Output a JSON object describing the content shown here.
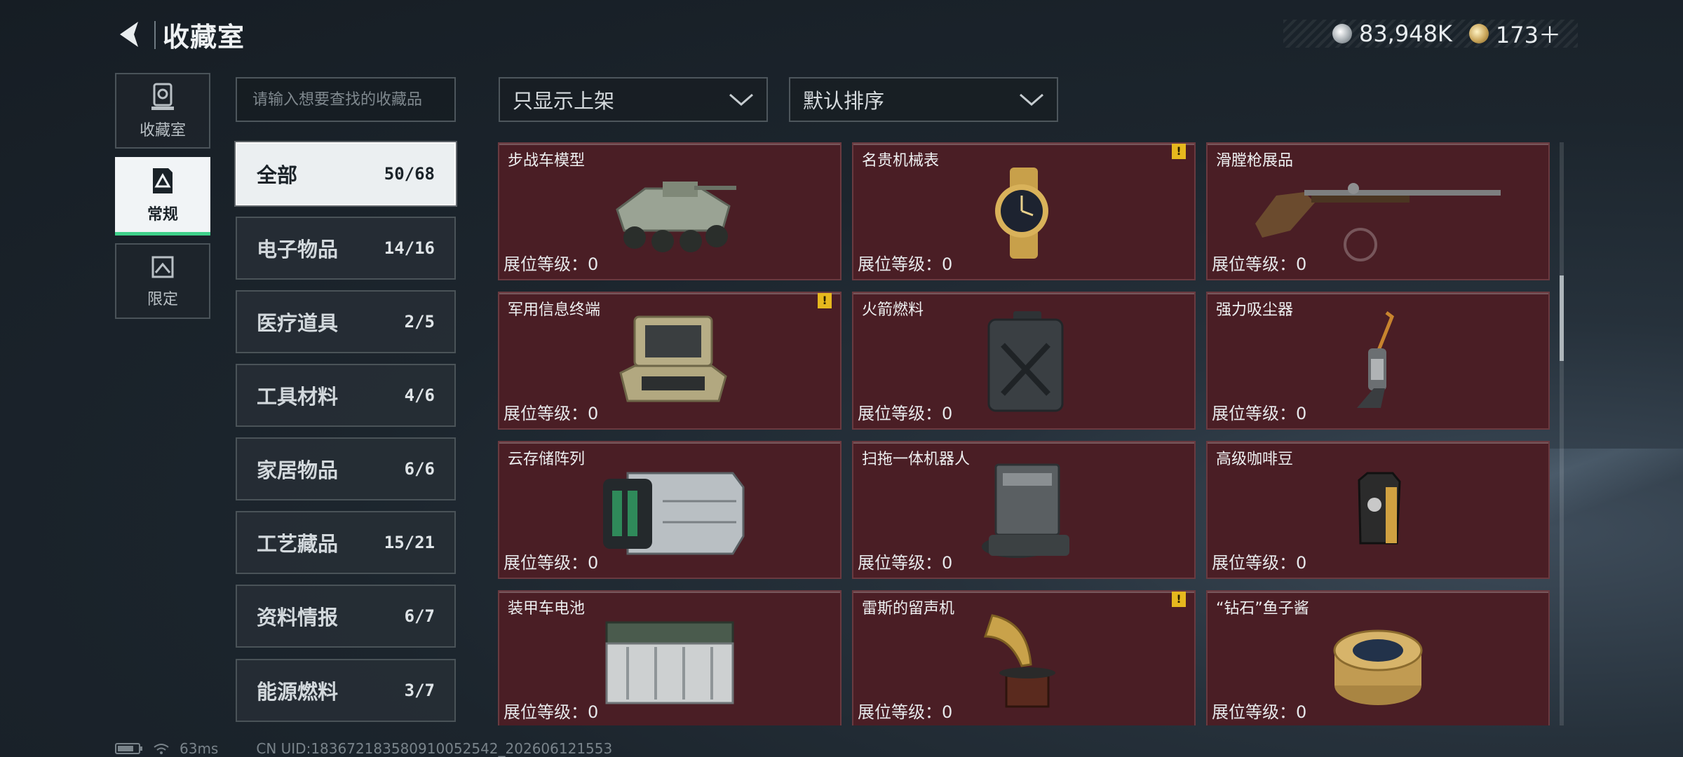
{
  "header": {
    "title": "收藏室"
  },
  "currency": [
    {
      "icon": "silver-coin-icon",
      "value": "83,948K"
    },
    {
      "icon": "gold-coin-icon",
      "value": "173＋"
    }
  ],
  "side_tabs": [
    {
      "label": "收藏室",
      "icon": "trophy-icon",
      "active": false
    },
    {
      "label": "常规",
      "icon": "warning-document-icon",
      "active": true
    },
    {
      "label": "限定",
      "icon": "limited-icon",
      "active": false
    }
  ],
  "search": {
    "placeholder": "请输入想要查找的收藏品"
  },
  "categories": [
    {
      "name": "全部",
      "count": "50/68",
      "active": true
    },
    {
      "name": "电子物品",
      "count": "14/16"
    },
    {
      "name": "医疗道具",
      "count": "2/5"
    },
    {
      "name": "工具材料",
      "count": "4/6"
    },
    {
      "name": "家居物品",
      "count": "6/6"
    },
    {
      "name": "工艺藏品",
      "count": "15/21"
    },
    {
      "name": "资料情报",
      "count": "6/7"
    },
    {
      "name": "能源燃料",
      "count": "3/7"
    }
  ],
  "filters": {
    "display": "只显示上架",
    "sort": "默认排序"
  },
  "items": [
    {
      "name": "步战车模型",
      "level": "展位等级：0",
      "warn": false
    },
    {
      "name": "名贵机械表",
      "level": "展位等级：0",
      "warn": true
    },
    {
      "name": "滑膛枪展品",
      "level": "展位等级：0",
      "warn": false
    },
    {
      "name": "军用信息终端",
      "level": "展位等级：0",
      "warn": true
    },
    {
      "name": "火箭燃料",
      "level": "展位等级：0",
      "warn": false
    },
    {
      "name": "强力吸尘器",
      "level": "展位等级：0",
      "warn": false
    },
    {
      "name": "云存储阵列",
      "level": "展位等级：0",
      "warn": false
    },
    {
      "name": "扫拖一体机器人",
      "level": "展位等级：0",
      "warn": false
    },
    {
      "name": "高级咖啡豆",
      "level": "展位等级：0",
      "warn": false
    },
    {
      "name": "装甲车电池",
      "level": "展位等级：0",
      "warn": false
    },
    {
      "name": "雷斯的留声机",
      "level": "展位等级：0",
      "warn": true
    },
    {
      "name": "“钻石”鱼子酱",
      "level": "展位等级：0",
      "warn": false
    }
  ],
  "footer": {
    "ping": "63ms",
    "uid": "CN UID:18367218358091005254​2_202606121553"
  },
  "colors": {
    "accent_green": "#3fd08a",
    "card_bg": "#4a1e25",
    "warn_yellow": "#e6b81e"
  }
}
